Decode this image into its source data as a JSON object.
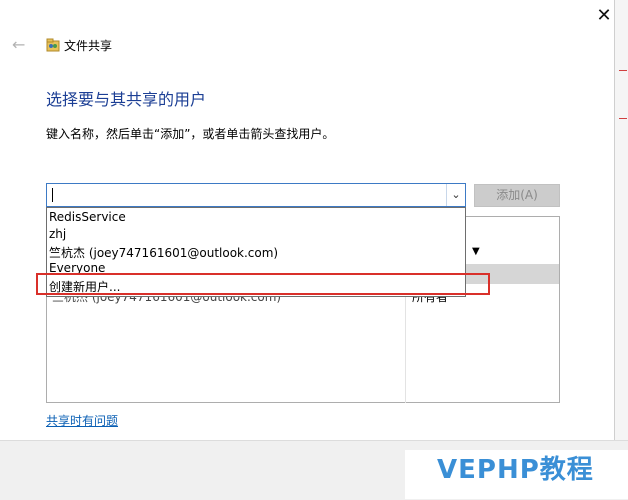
{
  "window": {
    "title": "文件共享",
    "close_glyph": "✕",
    "back_glyph": "←"
  },
  "main": {
    "heading": "选择要与其共享的用户",
    "instruction": "键入名称，然后单击“添加”，或者单击箭头查找用户。",
    "input_value": "",
    "add_button_label": "添加(A)",
    "dropdown_items": [
      "RedisService",
      "zhj",
      "竺杭杰 (joey747161601@outlook.com)",
      "Everyone",
      "创建新用户..."
    ],
    "table": {
      "rows": [
        {
          "user": "竺杭杰 (joey747161601@outlook.com)",
          "permission": "所有者"
        }
      ]
    },
    "help_link": "共享时有问题"
  },
  "watermark": "VEPHP教程",
  "colors": {
    "heading": "#1c3f95",
    "link": "#0a5fb4",
    "highlight_border": "#d9302a",
    "watermark": "#3a8fd6"
  }
}
